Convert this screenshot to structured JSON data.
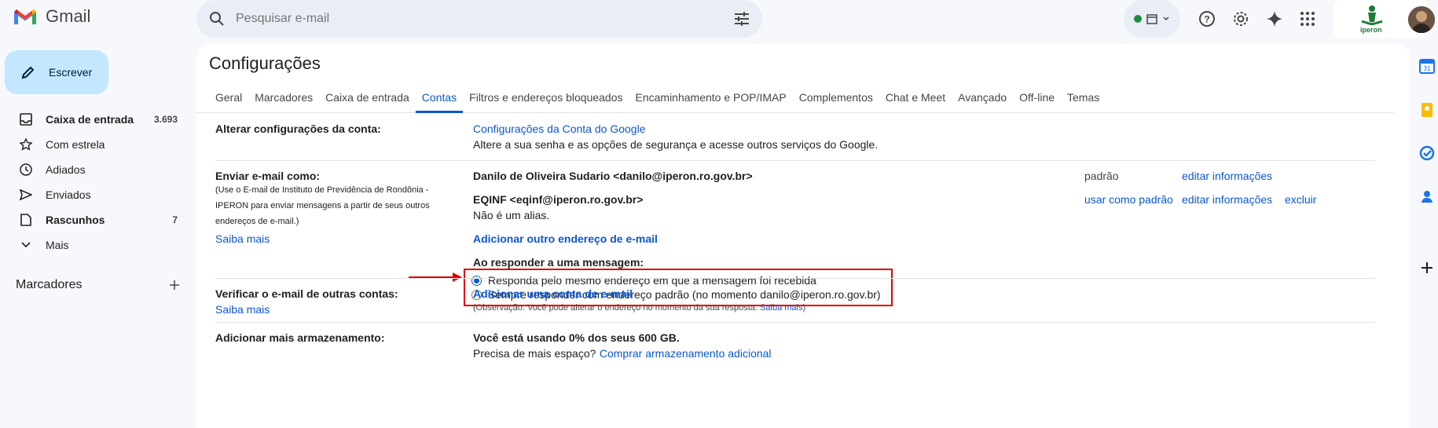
{
  "app": {
    "name": "Gmail",
    "accent": "#0b57d0",
    "compose_color": "#c2e7ff",
    "highlight_color": "#e10000"
  },
  "search": {
    "placeholder": "Pesquisar e-mail"
  },
  "org": {
    "name": "iperon"
  },
  "compose": {
    "label": "Escrever"
  },
  "sidebar": {
    "items": [
      {
        "label": "Caixa de entrada",
        "count": "3.693",
        "icon": "inbox-icon"
      },
      {
        "label": "Com estrela",
        "count": "",
        "icon": "star-icon"
      },
      {
        "label": "Adiados",
        "count": "",
        "icon": "clock-icon"
      },
      {
        "label": "Enviados",
        "count": "",
        "icon": "send-icon"
      },
      {
        "label": "Rascunhos",
        "count": "7",
        "icon": "draft-icon"
      },
      {
        "label": "Mais",
        "count": "",
        "icon": "chevron-down-icon"
      }
    ],
    "labels_header": "Marcadores"
  },
  "page": {
    "title": "Configurações"
  },
  "tabs": [
    "Geral",
    "Marcadores",
    "Caixa de entrada",
    "Contas",
    "Filtros e endereços bloqueados",
    "Encaminhamento e POP/IMAP",
    "Complementos",
    "Chat e Meet",
    "Avançado",
    "Off-line",
    "Temas"
  ],
  "active_tab": "Contas",
  "settings": {
    "account": {
      "label": "Alterar configurações da conta:",
      "link": "Configurações da Conta do Google",
      "desc": "Altere a sua senha e as opções de segurança e acesse outros serviços do Google."
    },
    "send_as": {
      "label": "Enviar e-mail como:",
      "desc_1": "(Use o E-mail de Instituto de Previdência de Rondônia -",
      "desc_2": "IPERON para enviar mensagens a partir de seus outros",
      "desc_3": "endereços de e-mail.)",
      "learn_more": "Saiba mais",
      "addr1": "Danilo de Oliveira Sudario <danilo@iperon.ro.gov.br>",
      "addr1_status": "padrão",
      "addr1_edit": "editar informações",
      "addr2": "EQINF <eqinf@iperon.ro.gov.br>",
      "addr2_note": "Não é um alias.",
      "addr2_default": "usar como padrão",
      "addr2_edit": "editar informações",
      "addr2_delete": "excluir",
      "add_other": "Adicionar outro endereço de e-mail",
      "reply_label": "Ao responder a uma mensagem:",
      "reply_opt1": "Responda pelo mesmo endereço em que a mensagem foi recebida",
      "reply_opt2": "Sempre responder com endereço padrão (no momento danilo@iperon.ro.gov.br)",
      "reply_selected": "Responda pelo mesmo endereço em que a mensagem foi recebida",
      "note_text": "(Observação: Você pode alterar o endereço no momento da sua resposta.",
      "note_link": "Saiba mais",
      "note_end": ")"
    },
    "check_mail": {
      "label": "Verificar o e-mail de outras contas:",
      "learn_more": "Saiba mais",
      "link": "Adicionar uma conta de e-mail"
    },
    "storage": {
      "label": "Adicionar mais armazenamento:",
      "usage": "Você está usando 0% dos seus 600 GB.",
      "need_more": "Precisa de mais espaço?",
      "buy_link": "Comprar armazenamento adicional"
    }
  }
}
